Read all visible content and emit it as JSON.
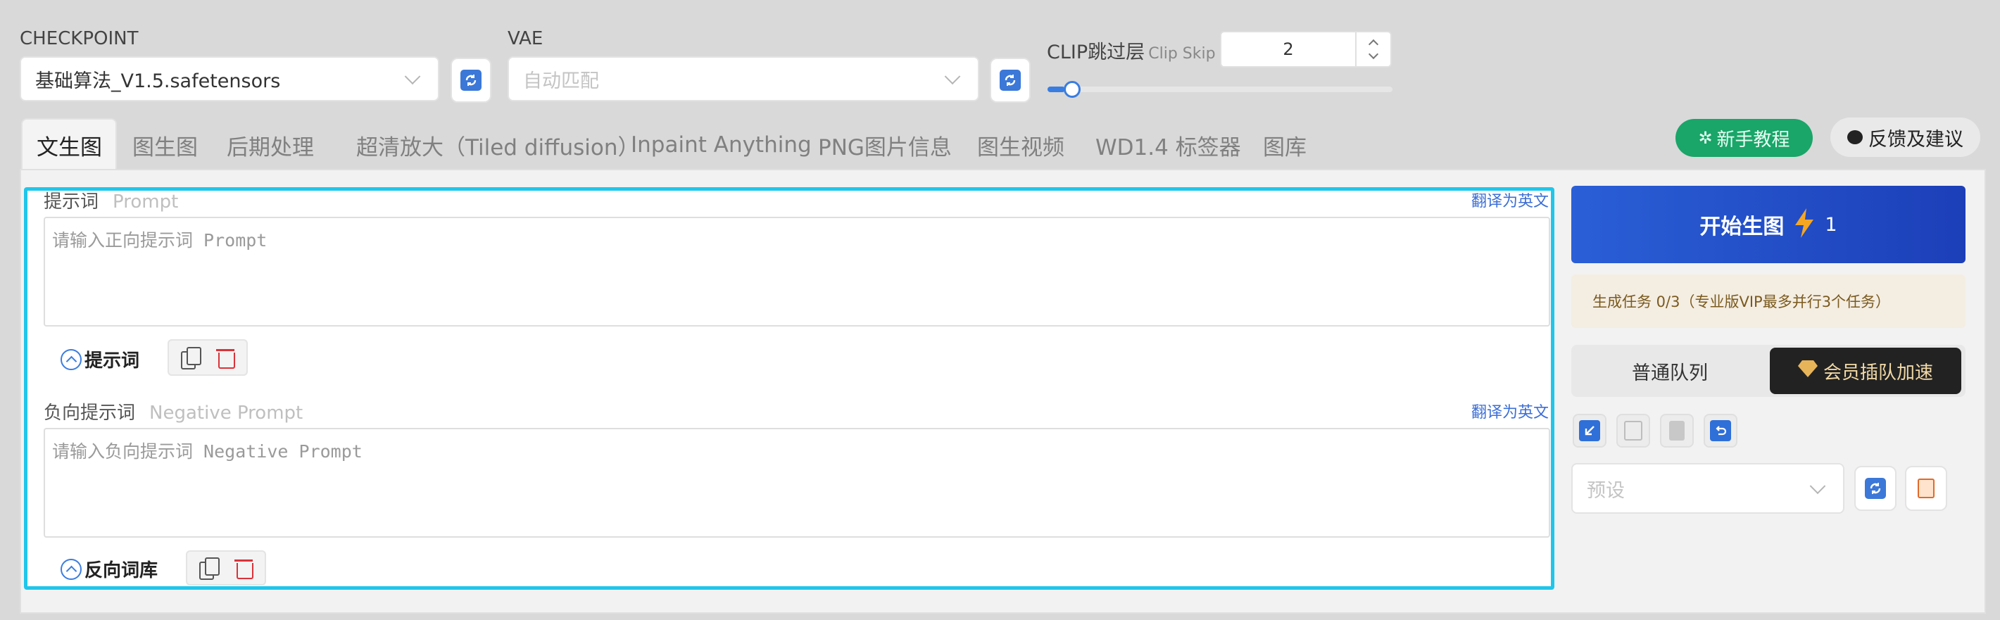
{
  "checkpoint": {
    "label": "CHECKPOINT",
    "value": "基础算法_V1.5.safetensors"
  },
  "vae": {
    "label": "VAE",
    "value": "自动匹配"
  },
  "clip": {
    "label": "CLIP跳过层",
    "sublabel": "Clip Skip",
    "value": "2",
    "slider_fraction": 0.05
  },
  "tabs": [
    {
      "label": "文生图",
      "active": true
    },
    {
      "label": "图生图"
    },
    {
      "label": "后期处理"
    },
    {
      "label": "超清放大（Tiled diffusion）"
    },
    {
      "label": "Inpaint Anything"
    },
    {
      "label": "PNG图片信息"
    },
    {
      "label": "图生视频"
    },
    {
      "label": "WD1.4 标签器"
    },
    {
      "label": "图库"
    }
  ],
  "header_buttons": {
    "tutorial": "新手教程",
    "feedback": "反馈及建议"
  },
  "prompt": {
    "title": "提示词",
    "title_en": "Prompt",
    "translate": "翻译为英文",
    "placeholder": "请输入正向提示词 Prompt",
    "toggle": "提示词"
  },
  "negative": {
    "title": "负向提示词",
    "title_en": "Negative Prompt",
    "translate": "翻译为英文",
    "placeholder": "请输入负向提示词 Negative Prompt",
    "toggle": "反向词库"
  },
  "generate": {
    "label": "开始生图",
    "count": "1"
  },
  "task_info": "生成任务 0/3（专业版VIP最多并行3个任务）",
  "queue": {
    "normal": "普通队列",
    "vip": "会员插队加速"
  },
  "preset": {
    "placeholder": "预设"
  },
  "colors": {
    "accent": "#20c6ea",
    "primary": "#1f4fcf",
    "green": "#1aa569",
    "dark": "#222222"
  }
}
